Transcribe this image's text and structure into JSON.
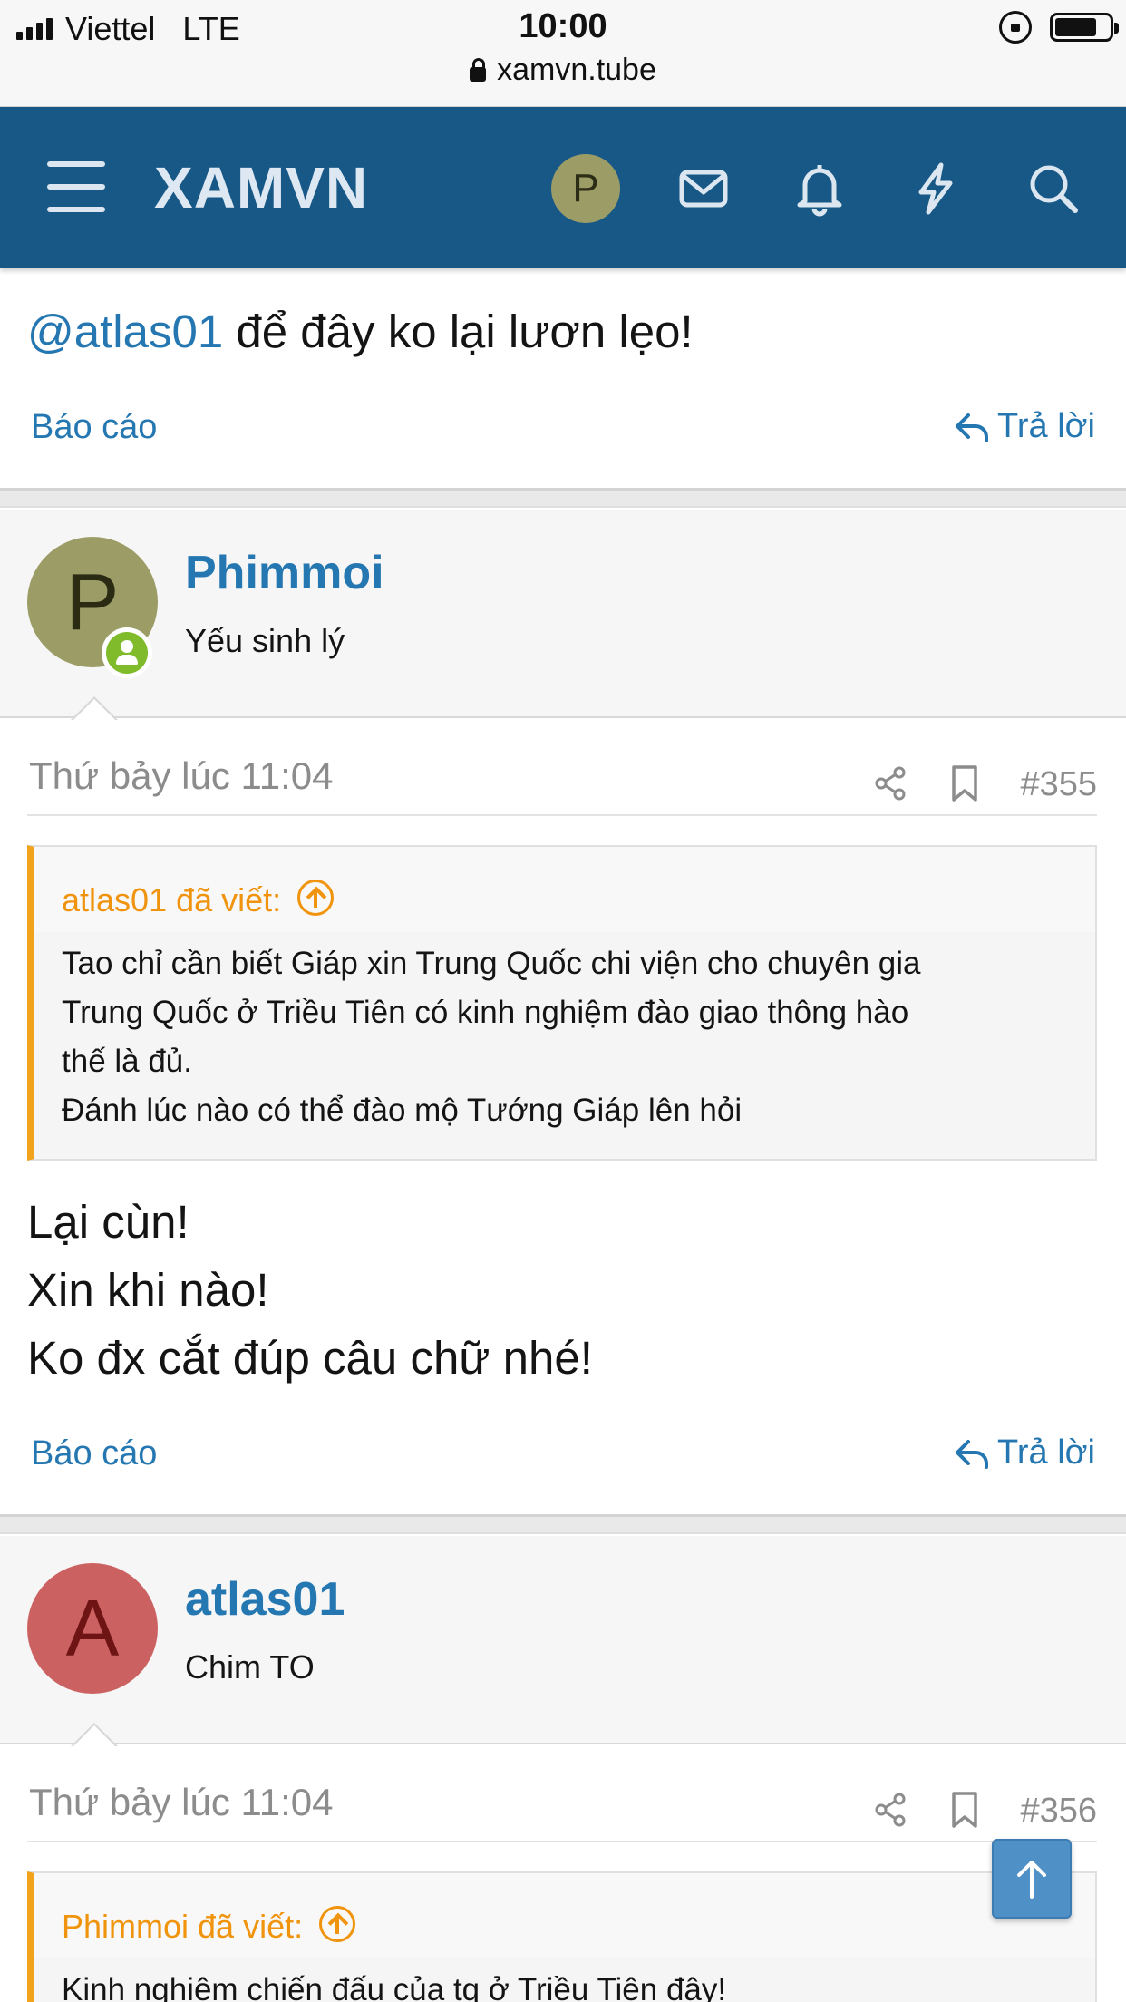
{
  "status_bar": {
    "carrier": "Viettel",
    "network": "LTE",
    "time": "10:00",
    "url": "xamvn.tube"
  },
  "header": {
    "logo": "XAMVN",
    "avatar_letter": "P",
    "icons": [
      "menu-icon",
      "mail-icon",
      "bell-icon",
      "lightning-icon",
      "search-icon"
    ],
    "bg_color": "#185886"
  },
  "top_post": {
    "mention": "@atlas01",
    "text": " để đây ko lại lươn lẹo!",
    "report_label": "Báo cáo",
    "reply_label": "Trả lời"
  },
  "posts": [
    {
      "author": "Phimmoi",
      "author_title": "Yếu sinh lý",
      "avatar_letter": "P",
      "avatar_color": "#9c9c66",
      "date": "Thứ bảy lúc 11:04",
      "number": "#355",
      "quote_author": "atlas01 đã viết:",
      "quote_lines": [
        "Tao chỉ cần biết Giáp xin Trung Quốc chi viện cho chuyên gia",
        "Trung Quốc ở Triều Tiên có kinh nghiệm đào giao thông hào",
        "thế là đủ.",
        "Đánh lúc nào có thể đào mộ Tướng Giáp lên hỏi"
      ],
      "body_lines": [
        "Lại cùn!",
        "Xin khi nào!",
        "Ko đx cắt đúp câu chữ nhé!"
      ],
      "report_label": "Báo cáo",
      "reply_label": "Trả lời"
    },
    {
      "author": "atlas01",
      "author_title": "Chim TO",
      "avatar_letter": "A",
      "avatar_color": "#cc6161",
      "date": "Thứ bảy lúc 11:04",
      "number": "#356",
      "quote_author": "Phimmoi đã viết:",
      "quote_lines": [
        "Kinh nghiệm chiến đấu của tq ở Triều Tiên đây!"
      ]
    }
  ],
  "colors": {
    "link": "#2577b1",
    "quote_accent": "#f1a31b",
    "online": "#7fbb2b"
  }
}
